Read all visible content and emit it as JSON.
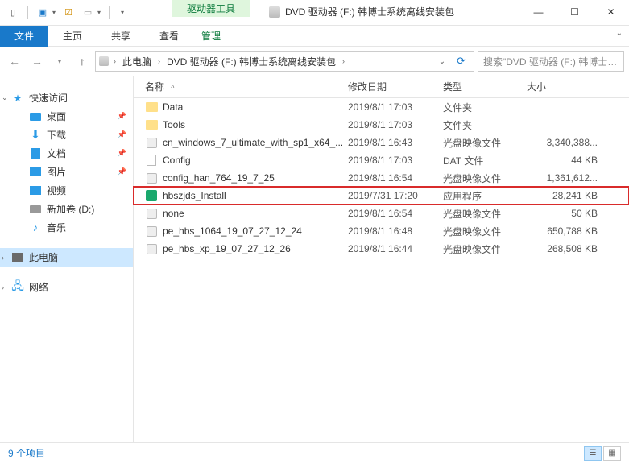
{
  "ribbon_contextual": "驱动器工具",
  "window_title": "DVD 驱动器 (F:) 韩博士系统离线安装包",
  "tabs": {
    "file": "文件",
    "home": "主页",
    "share": "共享",
    "view": "查看",
    "manage": "管理"
  },
  "breadcrumb": {
    "root": "此电脑",
    "drive": "DVD 驱动器 (F:) 韩博士系统离线安装包"
  },
  "search_placeholder": "搜索\"DVD 驱动器 (F:) 韩博士…",
  "nav": {
    "quick": "快速访问",
    "desktop": "桌面",
    "downloads": "下载",
    "documents": "文档",
    "pictures": "图片",
    "videos": "视频",
    "newvol": "新加卷 (D:)",
    "music": "音乐",
    "thispc": "此电脑",
    "network": "网络"
  },
  "columns": {
    "name": "名称",
    "date": "修改日期",
    "type": "类型",
    "size": "大小"
  },
  "files": [
    {
      "name": "Data",
      "date": "2019/8/1 17:03",
      "type": "文件夹",
      "size": "",
      "icon": "folder"
    },
    {
      "name": "Tools",
      "date": "2019/8/1 17:03",
      "type": "文件夹",
      "size": "",
      "icon": "folder"
    },
    {
      "name": "cn_windows_7_ultimate_with_sp1_x64_...",
      "date": "2019/8/1 16:43",
      "type": "光盘映像文件",
      "size": "3,340,388...",
      "icon": "iso"
    },
    {
      "name": "Config",
      "date": "2019/8/1 17:03",
      "type": "DAT 文件",
      "size": "44 KB",
      "icon": "dat"
    },
    {
      "name": "config_han_764_19_7_25",
      "date": "2019/8/1 16:54",
      "type": "光盘映像文件",
      "size": "1,361,612...",
      "icon": "iso"
    },
    {
      "name": "hbszjds_Install",
      "date": "2019/7/31 17:20",
      "type": "应用程序",
      "size": "28,241 KB",
      "icon": "exe",
      "highlight": true
    },
    {
      "name": "none",
      "date": "2019/8/1 16:54",
      "type": "光盘映像文件",
      "size": "50 KB",
      "icon": "iso"
    },
    {
      "name": "pe_hbs_1064_19_07_27_12_24",
      "date": "2019/8/1 16:48",
      "type": "光盘映像文件",
      "size": "650,788 KB",
      "icon": "iso"
    },
    {
      "name": "pe_hbs_xp_19_07_27_12_26",
      "date": "2019/8/1 16:44",
      "type": "光盘映像文件",
      "size": "268,508 KB",
      "icon": "iso"
    }
  ],
  "status": "9 个项目"
}
